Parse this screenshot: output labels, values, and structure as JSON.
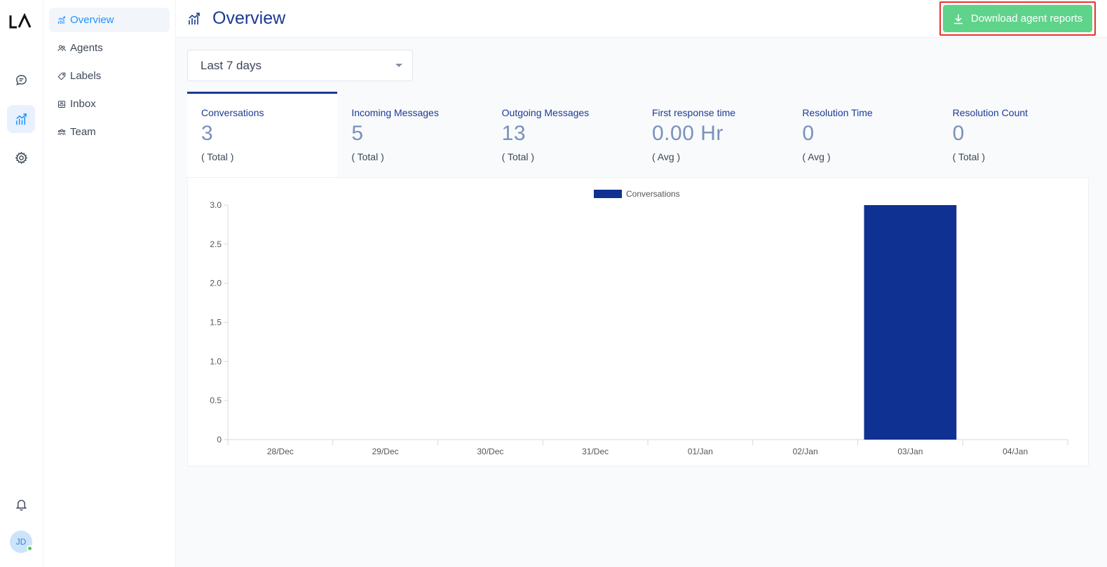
{
  "app": {
    "logo_text": "LA"
  },
  "rail": {
    "items": [
      {
        "name": "conversations",
        "icon": "chat-bubble-icon"
      },
      {
        "name": "reports",
        "icon": "chart-icon",
        "active": true
      },
      {
        "name": "settings",
        "icon": "gear-icon"
      }
    ],
    "notifications_icon": "bell-icon",
    "avatar_initials": "JD",
    "avatar_status_color": "#44ce4b"
  },
  "subnav": {
    "items": [
      {
        "label": "Overview",
        "icon": "chart-icon",
        "active": true
      },
      {
        "label": "Agents",
        "icon": "people-icon"
      },
      {
        "label": "Labels",
        "icon": "tag-icon"
      },
      {
        "label": "Inbox",
        "icon": "inbox-icon"
      },
      {
        "label": "Team",
        "icon": "team-icon"
      }
    ]
  },
  "header": {
    "title": "Overview",
    "download_label": "Download agent reports",
    "download_color": "#5fd38a"
  },
  "filter": {
    "selected": "Last 7 days"
  },
  "metrics": [
    {
      "label": "Conversations",
      "value": "3",
      "sub": "( Total )",
      "active": true
    },
    {
      "label": "Incoming Messages",
      "value": "5",
      "sub": "( Total )"
    },
    {
      "label": "Outgoing Messages",
      "value": "13",
      "sub": "( Total )"
    },
    {
      "label": "First response time",
      "value": "0.00 Hr",
      "sub": "( Avg )"
    },
    {
      "label": "Resolution Time",
      "value": "0",
      "sub": "( Avg )"
    },
    {
      "label": "Resolution Count",
      "value": "0",
      "sub": "( Total )"
    }
  ],
  "chart_data": {
    "type": "bar",
    "categories": [
      "28/Dec",
      "29/Dec",
      "30/Dec",
      "31/Dec",
      "01/Jan",
      "02/Jan",
      "03/Jan",
      "04/Jan"
    ],
    "series": [
      {
        "name": "Conversations",
        "values": [
          0,
          0,
          0,
          0,
          0,
          0,
          3,
          0
        ],
        "color": "#0e3192"
      }
    ],
    "ylim": [
      0,
      3
    ],
    "yticks": [
      "0",
      "0.5",
      "1.0",
      "1.5",
      "2.0",
      "2.5",
      "3.0"
    ],
    "legend": "top-center",
    "grid": false
  }
}
